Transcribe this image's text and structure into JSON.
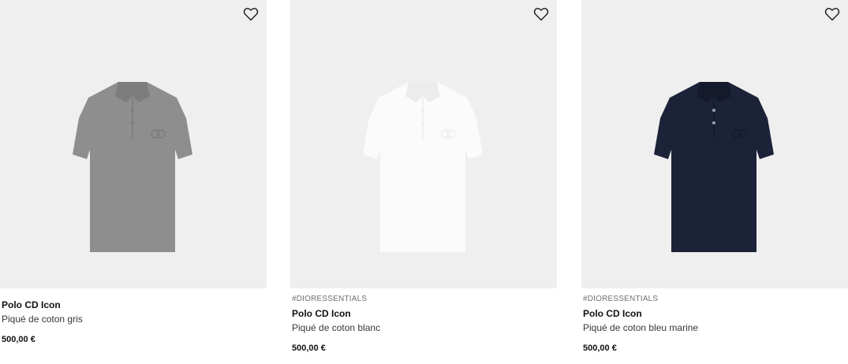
{
  "products": [
    {
      "tag": "",
      "name": "Polo CD Icon",
      "description": "Piqué de coton gris",
      "price": "500,00 €",
      "polo_color": "#8e8e8e",
      "polo_shade": "#7c7c7c",
      "wishlist_icon": "heart-outline-icon"
    },
    {
      "tag": "#DIORESSENTIALS",
      "name": "Polo CD Icon",
      "description": "Piqué de coton blanc",
      "price": "500,00 €",
      "polo_color": "#fbfbfb",
      "polo_shade": "#ececec",
      "wishlist_icon": "heart-outline-icon"
    },
    {
      "tag": "#DIORESSENTIALS",
      "name": "Polo CD Icon",
      "description": "Piqué de coton bleu marine",
      "price": "500,00 €",
      "polo_color": "#1c2338",
      "polo_shade": "#141a2b",
      "wishlist_icon": "heart-outline-icon"
    }
  ],
  "colors": {
    "image_background": "#efefef",
    "text_primary": "#111111",
    "text_secondary": "#33383c",
    "tag_text": "#6b7075"
  }
}
